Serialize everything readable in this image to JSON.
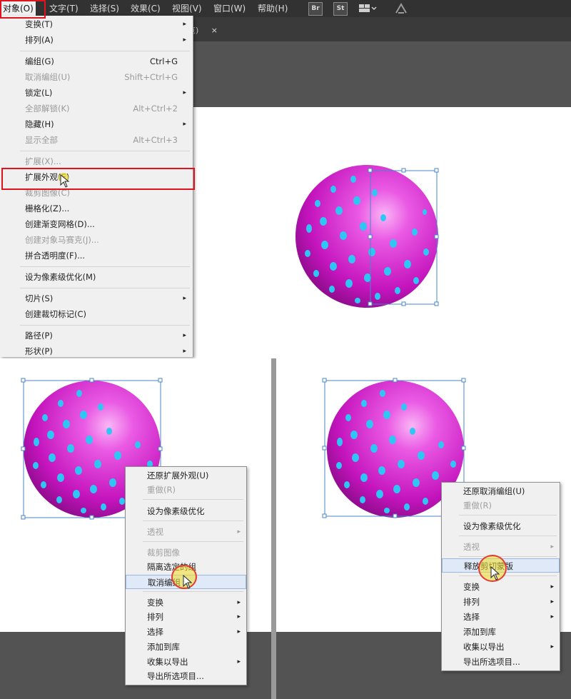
{
  "menubar": {
    "items": [
      "对象(O)",
      "文字(T)",
      "选择(S)",
      "效果(C)",
      "视图(V)",
      "窗口(W)",
      "帮助(H)"
    ],
    "active_index": 0,
    "icons": [
      "Br",
      "St"
    ],
    "layout_icon": "workspace-layout-icon",
    "sync_icon": "sync-icon"
  },
  "doc_tab": {
    "title_fragment": "览)",
    "close": "×"
  },
  "object_menu": {
    "items": [
      {
        "label": "变换(T)",
        "submenu": true
      },
      {
        "label": "排列(A)",
        "submenu": true
      },
      {
        "label": "编组(G)",
        "shortcut": "Ctrl+G"
      },
      {
        "label": "取消编组(U)",
        "shortcut": "Shift+Ctrl+G",
        "disabled": true
      },
      {
        "label": "锁定(L)",
        "submenu": true
      },
      {
        "label": "全部解锁(K)",
        "shortcut": "Alt+Ctrl+2",
        "disabled": true
      },
      {
        "label": "隐藏(H)",
        "submenu": true
      },
      {
        "label": "显示全部",
        "shortcut": "Alt+Ctrl+3",
        "disabled": true
      },
      {
        "label": "扩展(X)...",
        "disabled": true
      },
      {
        "label": "扩展外观(E)",
        "highlighted": true
      },
      {
        "label": "裁剪图像(C)",
        "disabled": true
      },
      {
        "label": "栅格化(Z)..."
      },
      {
        "label": "创建渐变网格(D)..."
      },
      {
        "label": "创建对象马赛克(J)...",
        "disabled": true
      },
      {
        "label": "拼合透明度(F)..."
      },
      {
        "label": "设为像素级优化(M)"
      },
      {
        "label": "切片(S)",
        "submenu": true
      },
      {
        "label": "创建裁切标记(C)"
      },
      {
        "label": "路径(P)",
        "submenu": true
      },
      {
        "label": "形状(P)",
        "submenu": true
      }
    ]
  },
  "context_menu_left": {
    "items": [
      {
        "label": "还原扩展外观(U)"
      },
      {
        "label": "重做(R)",
        "disabled": true
      },
      {
        "label": "设为像素级优化"
      },
      {
        "label": "透视",
        "submenu": true,
        "disabled": true
      },
      {
        "label": "裁剪图像",
        "disabled": true
      },
      {
        "label": "隔离选定的组"
      },
      {
        "label": "取消编组",
        "highlighted": true
      },
      {
        "label": "变换",
        "submenu": true
      },
      {
        "label": "排列",
        "submenu": true
      },
      {
        "label": "选择",
        "submenu": true
      },
      {
        "label": "添加到库"
      },
      {
        "label": "收集以导出",
        "submenu": true
      },
      {
        "label": "导出所选项目..."
      }
    ]
  },
  "context_menu_right": {
    "items": [
      {
        "label": "还原取消编组(U)"
      },
      {
        "label": "重做(R)",
        "disabled": true
      },
      {
        "label": "设为像素级优化"
      },
      {
        "label": "透视",
        "submenu": true,
        "disabled": true
      },
      {
        "label": "释放剪切蒙版",
        "highlighted": true
      },
      {
        "label": "变换",
        "submenu": true
      },
      {
        "label": "排列",
        "submenu": true
      },
      {
        "label": "选择",
        "submenu": true
      },
      {
        "label": "添加到库"
      },
      {
        "label": "收集以导出",
        "submenu": true
      },
      {
        "label": "导出所选项目..."
      }
    ]
  },
  "colors": {
    "sphere": "#d21ccd",
    "sphere_highlight": "#f6a6f2",
    "dots": "#2ec6f3",
    "selection": "#4a86c8",
    "highlight_box": "#e0141e",
    "menubar": "#323232",
    "workspace": "#535353"
  },
  "arrow_glyph": "▸"
}
